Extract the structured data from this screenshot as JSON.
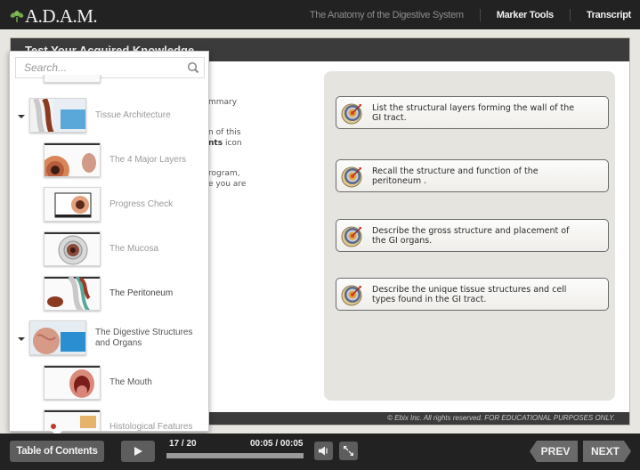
{
  "app": {
    "logo_text": "ADAM",
    "logo_display": "A.D.A.M.",
    "course_title": "The Anatomy of the Digestive System",
    "nav": [
      {
        "label": "Marker Tools"
      },
      {
        "label": "Transcript"
      }
    ]
  },
  "slide": {
    "title": "Test Your Acquired Knowledge",
    "left_text_fragments": [
      {
        "line1": "mmary",
        "line2": ""
      },
      {
        "line1": "n of this",
        "line2_bold": "nts",
        "line2_rest": " icon"
      },
      {
        "line1": "rogram,",
        "line2": "e you are"
      }
    ],
    "objectives": [
      {
        "icon": "target-icon",
        "text": "List the structural layers forming the wall of the GI tract."
      },
      {
        "icon": "target-icon",
        "text": "Recall the structure and function of the peritoneum ."
      },
      {
        "icon": "target-icon",
        "text": "Describe the gross structure and placement of the GI organs."
      },
      {
        "icon": "target-icon",
        "text": "Describe the unique tissue structures and cell types found in the GI tract."
      }
    ],
    "copyright": "© Ebix Inc. All rights reserved. FOR EDUCATIONAL PURPOSES ONLY."
  },
  "toc": {
    "search_placeholder": "Search...",
    "items": [
      {
        "type": "section",
        "label": "Tissue Architecture",
        "expanded": true
      },
      {
        "type": "page",
        "label": "The 4 Major Layers"
      },
      {
        "type": "page",
        "label": "Progress Check"
      },
      {
        "type": "page",
        "label": "The Mucosa"
      },
      {
        "type": "page",
        "label": "The Peritoneum",
        "active": true
      },
      {
        "type": "section",
        "label": "The Digestive Structures and Organs",
        "expanded": true
      },
      {
        "type": "page",
        "label": "The Mouth"
      },
      {
        "type": "page",
        "label": "Histological Features"
      }
    ]
  },
  "player": {
    "toc_button": "Table of Contents",
    "play_icon": "play-icon",
    "slide_counter": "17 / 20",
    "time": "00:05 / 00:05",
    "progress_fraction": 1.0,
    "audio_icon": "speaker-icon",
    "fullscreen_icon": "expand-icon",
    "prev": "PREV",
    "next": "NEXT"
  },
  "colors": {
    "topbar": "#222222",
    "stage_header": "#3b3b3b",
    "button": "#5d5d5d",
    "objective_panel": "#e6e4df",
    "logo_leaf": "#6fa84a"
  }
}
